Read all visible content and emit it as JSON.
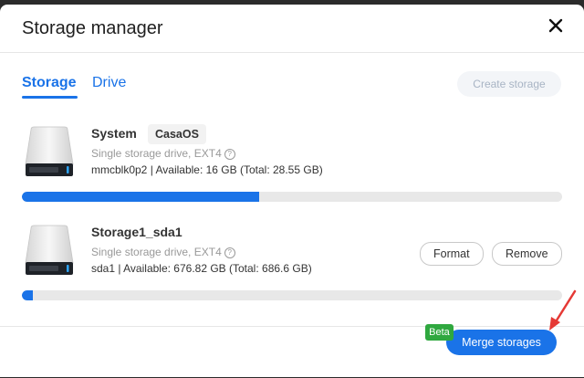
{
  "dialog": {
    "title": "Storage manager",
    "tabs": [
      {
        "label": "Storage",
        "active": true
      },
      {
        "label": "Drive",
        "active": false
      }
    ],
    "create_storage_label": "Create storage",
    "storages": [
      {
        "name": "System",
        "tag": "CasaOS",
        "type": "Single storage drive, EXT4",
        "details": "mmcblk0p2 | Available: 16 GB (Total: 28.55 GB)",
        "usage_fraction": 0.44
      },
      {
        "name": "Storage1_sda1",
        "type": "Single storage drive, EXT4",
        "details": "sda1 | Available: 676.82 GB (Total: 686.6 GB)",
        "usage_fraction": 0.02,
        "actions": {
          "format_label": "Format",
          "remove_label": "Remove"
        }
      }
    ],
    "footer": {
      "beta_label": "Beta",
      "merge_label": "Merge storages"
    },
    "colors": {
      "accent": "#1a73e8",
      "beta": "#2fa83f",
      "annotation_arrow": "#e53935"
    }
  }
}
